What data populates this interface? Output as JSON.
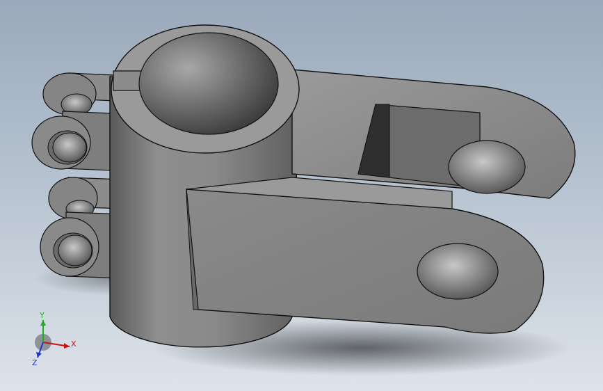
{
  "viewport": {
    "background_top": "#9aa9bb",
    "background_bottom": "#dde3ea",
    "model_color": "#8a8a8a"
  },
  "triad": {
    "x_label": "X",
    "y_label": "Y",
    "z_label": "Z",
    "x_color": "#cc1111",
    "y_color": "#22aa22",
    "z_color": "#2233cc"
  }
}
